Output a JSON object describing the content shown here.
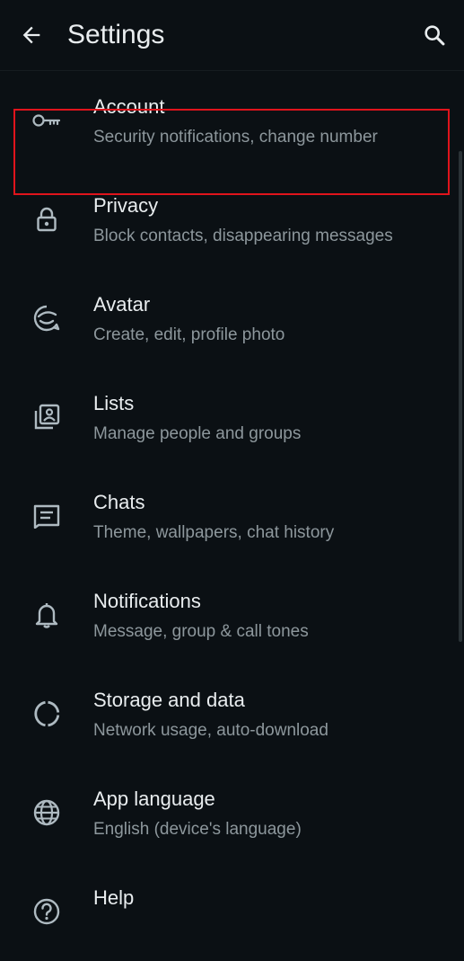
{
  "header": {
    "title": "Settings",
    "back_icon": "arrow-left-icon",
    "search_icon": "search-icon"
  },
  "items": [
    {
      "label": "Account",
      "sub": "Security notifications, change number",
      "icon": "key-icon"
    },
    {
      "label": "Privacy",
      "sub": "Block contacts, disappearing messages",
      "icon": "lock-icon"
    },
    {
      "label": "Avatar",
      "sub": "Create, edit, profile photo",
      "icon": "avatar-icon"
    },
    {
      "label": "Lists",
      "sub": "Manage people and groups",
      "icon": "contacts-list-icon"
    },
    {
      "label": "Chats",
      "sub": "Theme, wallpapers, chat history",
      "icon": "chat-icon"
    },
    {
      "label": "Notifications",
      "sub": "Message, group & call tones",
      "icon": "bell-icon"
    },
    {
      "label": "Storage and data",
      "sub": "Network usage, auto-download",
      "icon": "storage-icon"
    },
    {
      "label": "App language",
      "sub": "English (device's language)",
      "icon": "globe-icon"
    },
    {
      "label": "Help",
      "sub": "",
      "icon": "help-icon"
    }
  ],
  "colors": {
    "background": "#0b1014",
    "primary_text": "#e9edef",
    "secondary_text": "#8d979c",
    "icon": "#aebac1",
    "highlight_border": "#e0141c"
  }
}
